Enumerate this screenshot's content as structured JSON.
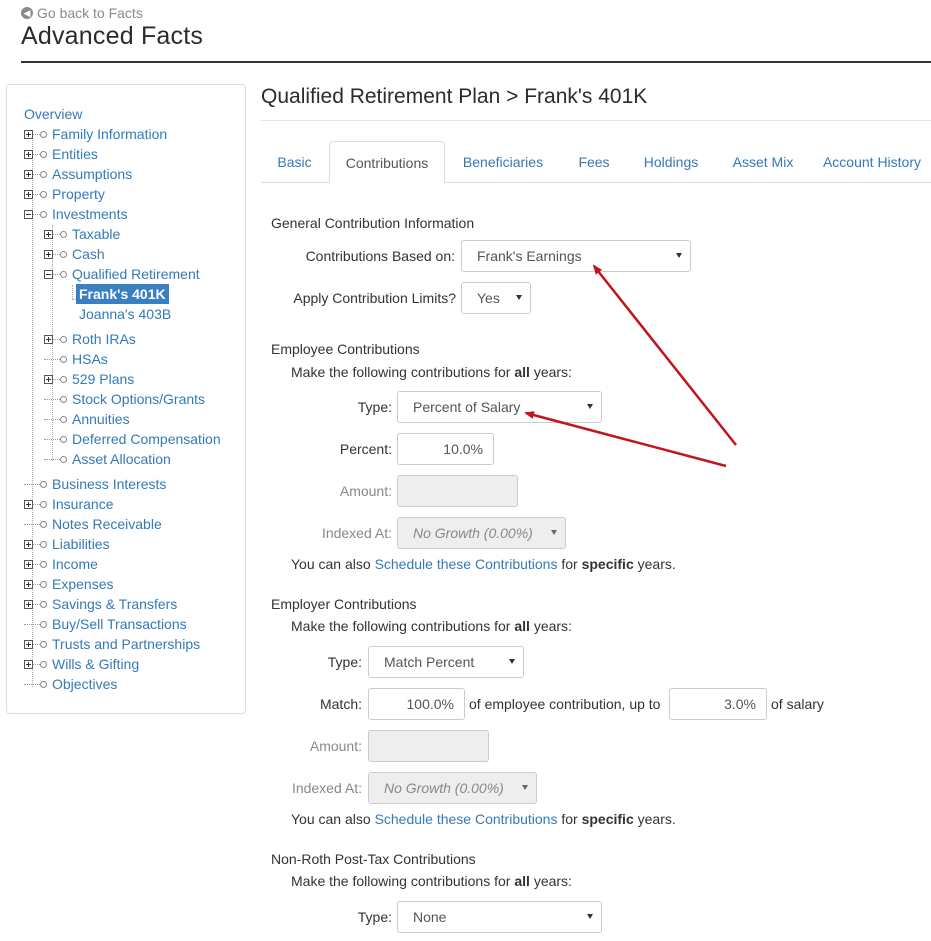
{
  "header": {
    "back_link": "Go back to Facts",
    "title": "Advanced Facts"
  },
  "sidebar": {
    "overview": "Overview",
    "items": [
      "Family Information",
      "Entities",
      "Assumptions",
      "Property",
      "Investments",
      "Taxable",
      "Cash",
      "Qualified Retirement",
      "Frank's 401K",
      "Joanna's 403B",
      "Roth IRAs",
      "HSAs",
      "529 Plans",
      "Stock Options/Grants",
      "Annuities",
      "Deferred Compensation",
      "Asset Allocation",
      "Business Interests",
      "Insurance",
      "Notes Receivable",
      "Liabilities",
      "Income",
      "Expenses",
      "Savings & Transfers",
      "Buy/Sell Transactions",
      "Trusts and Partnerships",
      "Wills & Gifting",
      "Objectives"
    ]
  },
  "content": {
    "title": "Qualified Retirement Plan > Frank's 401K",
    "tabs": [
      "Basic",
      "Contributions",
      "Beneficiaries",
      "Fees",
      "Holdings",
      "Asset Mix",
      "Account History"
    ]
  },
  "general": {
    "title": "General Contribution Information",
    "based_on_label": "Contributions Based on:",
    "based_on_value": "Frank's Earnings",
    "limits_label": "Apply Contribution Limits?",
    "limits_value": "Yes"
  },
  "common": {
    "make_prefix": "Make the following contributions for",
    "all": "all",
    "years": "years:",
    "also_prefix": "You can also",
    "schedule_link": "Schedule these Contributions",
    "for": "for",
    "specific": "specific",
    "years_dot": "years."
  },
  "employee": {
    "title": "Employee Contributions",
    "type_label": "Type:",
    "type_value": "Percent of Salary",
    "percent_label": "Percent:",
    "percent_value": "10.0%",
    "amount_label": "Amount:",
    "indexed_label": "Indexed At:",
    "indexed_value": "No Growth (0.00%)"
  },
  "employer": {
    "title": "Employer Contributions",
    "type_label": "Type:",
    "type_value": "Match Percent",
    "match_label": "Match:",
    "match_value": "100.0%",
    "mid_text": "of employee contribution, up to",
    "upto_value": "3.0%",
    "tail_text": "of salary",
    "amount_label": "Amount:",
    "indexed_label": "Indexed At:",
    "indexed_value": "No Growth (0.00%)"
  },
  "nonroth": {
    "title": "Non-Roth Post-Tax Contributions",
    "type_label": "Type:",
    "type_value": "None"
  },
  "colors": {
    "link": "#337ab7",
    "selected_bg": "#3a7fc2",
    "annotation_arrow": "#c0161b"
  }
}
